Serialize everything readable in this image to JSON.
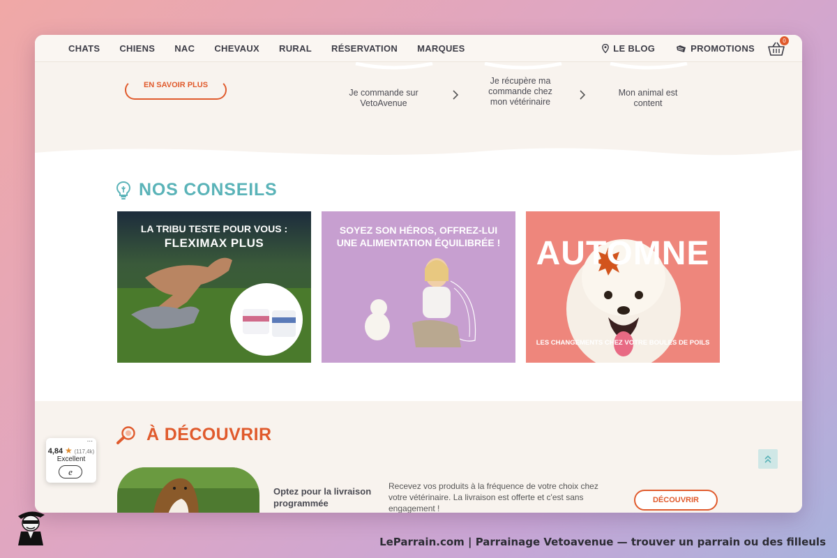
{
  "nav": {
    "left_items": [
      "CHATS",
      "CHIENS",
      "NAC",
      "CHEVAUX",
      "RURAL",
      "RÉSERVATION",
      "MARQUES"
    ],
    "blog_label": "LE BLOG",
    "promotions_label": "PROMOTIONS",
    "cart_count": "0"
  },
  "steps": {
    "learn_more_label": "EN SAVOIR PLUS",
    "items": [
      "Je commande sur VetoAvenue",
      "Je récupère ma commande chez mon vétérinaire",
      "Mon animal est content"
    ]
  },
  "conseils": {
    "title": "NOS CONSEILS",
    "cards": [
      {
        "line1": "LA TRIBU TESTE POUR VOUS :",
        "line2": "FLEXIMAX PLUS"
      },
      {
        "line1": "SOYEZ SON HÉROS, OFFREZ-LUI",
        "line2": "UNE ALIMENTATION ÉQUILIBRÉE !"
      },
      {
        "headline": "AUTOMNE",
        "subline": "LES CHANGEMENTS CHEZ VOTRE BOULES DE POILS"
      }
    ]
  },
  "decouvrir": {
    "title": "À DÉCOUVRIR",
    "promo_heading": "Optez pour la livraison programmée",
    "promo_text": "Recevez vos produits à la fréquence de votre choix chez votre vétérinaire. La livraison est offerte et c'est sans engagement !",
    "button_label": "DÉCOUVRIR"
  },
  "rating_widget": {
    "score": "4,84",
    "count": "(117,4k)",
    "label": "Excellent",
    "badge": "e",
    "menu": "..."
  },
  "caption": "LeParrain.com | Parrainage Vetoavenue — trouver un parrain ou des filleuls",
  "colors": {
    "accent_orange": "#e05a2c",
    "accent_teal": "#5ab3b8",
    "section_beige": "#f8f3ee",
    "card_purple": "#c79fd0",
    "card_salmon": "#ee867c"
  }
}
